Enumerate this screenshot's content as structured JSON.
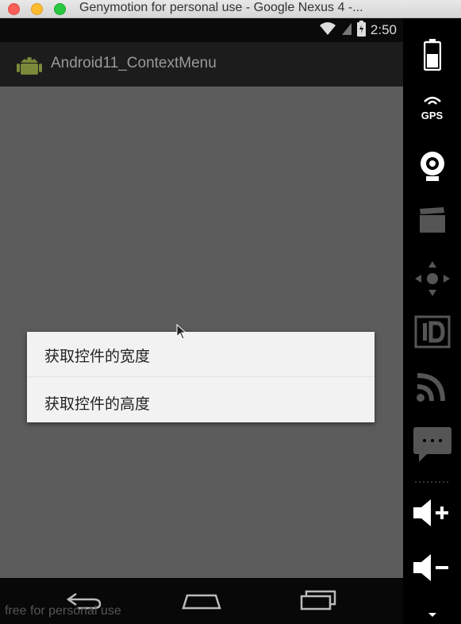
{
  "window": {
    "title": "Genymotion for personal use - Google Nexus 4 -..."
  },
  "statusbar": {
    "time": "2:50",
    "icons": [
      "wifi-icon",
      "signal-icon",
      "battery-icon"
    ]
  },
  "actionbar": {
    "app_title": "Android11_ContextMenu",
    "icon": "android-icon"
  },
  "context_menu": {
    "items": [
      {
        "label": "获取控件的宽度"
      },
      {
        "label": "获取控件的高度"
      }
    ]
  },
  "navbar": {
    "watermark": "free for personal use",
    "buttons": [
      "back-icon",
      "home-icon",
      "recents-icon"
    ]
  },
  "toolbar": {
    "gps_label": "GPS",
    "buttons": [
      "battery-icon",
      "gps-icon",
      "camera-icon",
      "video-icon",
      "dpad-icon",
      "id-icon",
      "cast-icon",
      "sms-icon",
      "volume-up-icon",
      "volume-down-icon",
      "more-icon"
    ]
  },
  "colors": {
    "content_bg": "#5c5c5c",
    "menu_bg": "#f2f2f2",
    "close": "#fc5f57",
    "minimize": "#fdbc2e",
    "maximize": "#29c840"
  }
}
